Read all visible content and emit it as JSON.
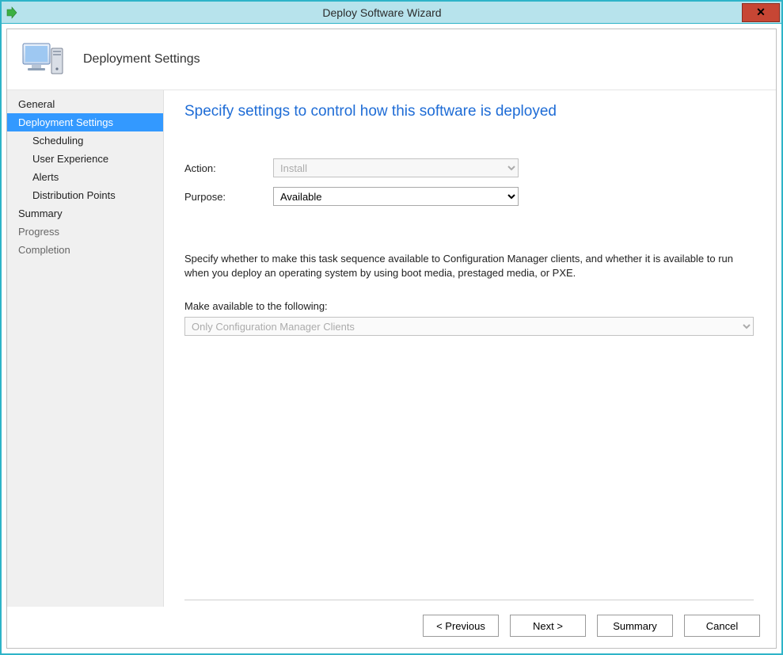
{
  "window": {
    "title": "Deploy Software Wizard",
    "close_glyph": "✕"
  },
  "header": {
    "page_title": "Deployment Settings"
  },
  "sidebar": {
    "items": [
      {
        "label": "General",
        "indent": false,
        "selected": false,
        "dim": false
      },
      {
        "label": "Deployment Settings",
        "indent": false,
        "selected": true,
        "dim": false
      },
      {
        "label": "Scheduling",
        "indent": true,
        "selected": false,
        "dim": false
      },
      {
        "label": "User Experience",
        "indent": true,
        "selected": false,
        "dim": false
      },
      {
        "label": "Alerts",
        "indent": true,
        "selected": false,
        "dim": false
      },
      {
        "label": "Distribution Points",
        "indent": true,
        "selected": false,
        "dim": false
      },
      {
        "label": "Summary",
        "indent": false,
        "selected": false,
        "dim": false
      },
      {
        "label": "Progress",
        "indent": false,
        "selected": false,
        "dim": true
      },
      {
        "label": "Completion",
        "indent": false,
        "selected": false,
        "dim": true
      }
    ]
  },
  "content": {
    "heading": "Specify settings to control how this software is deployed",
    "action_label": "Action:",
    "action_value": "Install",
    "action_disabled": true,
    "purpose_label": "Purpose:",
    "purpose_value": "Available",
    "purpose_disabled": false,
    "explain": "Specify whether to make this task sequence available to Configuration Manager clients, and whether it is available to run when you deploy an operating system by using boot media, prestaged media, or PXE.",
    "availability_label": "Make available to the following:",
    "availability_value": "Only Configuration Manager Clients",
    "availability_disabled": true
  },
  "footer": {
    "previous": "< Previous",
    "next": "Next >",
    "summary": "Summary",
    "cancel": "Cancel"
  }
}
